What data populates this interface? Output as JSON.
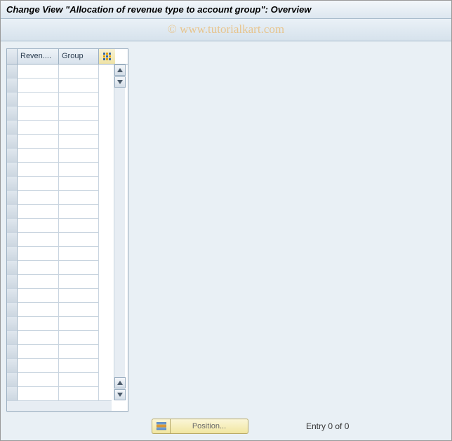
{
  "title": "Change View \"Allocation of revenue type to account group\": Overview",
  "watermark": "© www.tutorialkart.com",
  "table": {
    "columns": {
      "col1": "Reven....",
      "col2": "Group"
    },
    "row_count": 24,
    "rows": [
      {
        "c1": "",
        "c2": ""
      },
      {
        "c1": "",
        "c2": ""
      },
      {
        "c1": "",
        "c2": ""
      },
      {
        "c1": "",
        "c2": ""
      },
      {
        "c1": "",
        "c2": ""
      },
      {
        "c1": "",
        "c2": ""
      },
      {
        "c1": "",
        "c2": ""
      },
      {
        "c1": "",
        "c2": ""
      },
      {
        "c1": "",
        "c2": ""
      },
      {
        "c1": "",
        "c2": ""
      },
      {
        "c1": "",
        "c2": ""
      },
      {
        "c1": "",
        "c2": ""
      },
      {
        "c1": "",
        "c2": ""
      },
      {
        "c1": "",
        "c2": ""
      },
      {
        "c1": "",
        "c2": ""
      },
      {
        "c1": "",
        "c2": ""
      },
      {
        "c1": "",
        "c2": ""
      },
      {
        "c1": "",
        "c2": ""
      },
      {
        "c1": "",
        "c2": ""
      },
      {
        "c1": "",
        "c2": ""
      },
      {
        "c1": "",
        "c2": ""
      },
      {
        "c1": "",
        "c2": ""
      },
      {
        "c1": "",
        "c2": ""
      },
      {
        "c1": "",
        "c2": ""
      }
    ]
  },
  "footer": {
    "position_label": "Position...",
    "entry_label": "Entry 0 of 0"
  }
}
